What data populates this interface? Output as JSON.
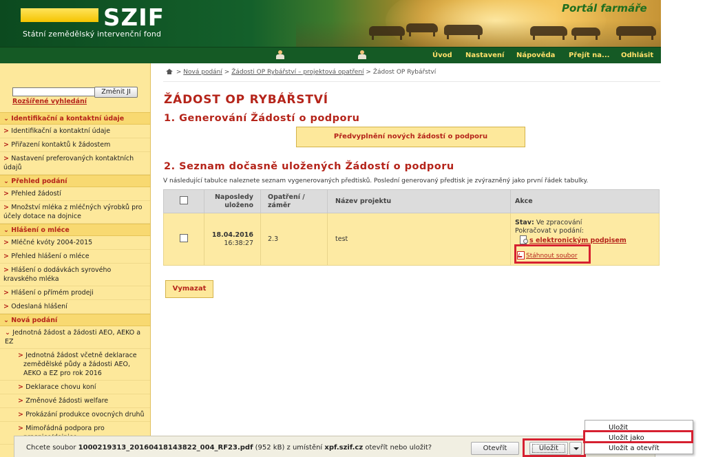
{
  "header": {
    "logo_text": "SZIF",
    "logo_subtitle": "Státní zemědělský intervenční fond",
    "portal_title": "Portál farmáře"
  },
  "nav": {
    "links": [
      "Úvod",
      "Nastavení",
      "Nápověda",
      "Přejít na...",
      "Odhlásit"
    ]
  },
  "sidebar": {
    "search_placeholder": "",
    "search_button": "Změnit JI",
    "advanced_search": "Rozšířené vyhledání",
    "sections": [
      {
        "title": "Identifikační a kontaktní údaje",
        "items": [
          "Identifikační a kontaktní údaje",
          "Přiřazení kontaktů k žádostem",
          "Nastavení preferovaných kontaktních údajů"
        ]
      },
      {
        "title": "Přehled podání",
        "items": [
          "Přehled žádostí",
          "Množství mléka z mléčných výrobků pro účely dotace na dojnice"
        ]
      },
      {
        "title": "Hlášení o mléce",
        "items": [
          "Mléčné kvóty 2004-2015",
          "Přehled hlášení o mléce",
          "Hlášení o dodávkách syrového kravského mléka",
          "Hlášení o přímém prodeji",
          "Odeslaná hlášení"
        ]
      },
      {
        "title": "Nová podání",
        "items": []
      }
    ],
    "nova_podani_group": "Jednotná žádost a žádosti AEO, AEKO a EZ",
    "nova_podani_subitems": [
      "Jednotná žádost včetně deklarace zemědělské půdy a žádosti AEO, AEKO a EZ pro rok 2016",
      "Deklarace chovu koní",
      "Změnové žádosti welfare",
      "Prokázání produkce ovocných druhů",
      "Mimořádná podpora pro prasnice/dojnice"
    ]
  },
  "breadcrumb": {
    "items": [
      "Nová podání",
      "Žádosti OP Rybářství – projektová opatření"
    ],
    "current": "Žádost OP Rybářství",
    "sep": ">"
  },
  "main": {
    "title": "ŽÁDOST OP RYBÁŘSTVÍ",
    "section1": "1. Generování Žádostí o podporu",
    "prefill_button": "Předvyplnění nových žádostí o podporu",
    "section2": "2. Seznam dočasně uložených Žádostí o podporu",
    "info": "V následující tabulce naleznete seznam vygenerovaných předtisků. Poslední generovaný předtisk je zvýrazněný jako první řádek tabulky.",
    "delete_button": "Vymazat"
  },
  "table": {
    "headers": {
      "saved": "Naposledy uloženo",
      "measure": "Opatření / záměr",
      "project": "Název projektu",
      "actions": "Akce"
    },
    "rows": [
      {
        "date": "18.04.2016",
        "time": "16:38:27",
        "measure": "2.3",
        "project": "test",
        "status_label": "Stav:",
        "status_value": "Ve zpracování",
        "continue_label": "Pokračovat v podání:",
        "sign_link": "s elektronickým podpisem",
        "download_link": "Stáhnout soubor"
      }
    ]
  },
  "download_bar": {
    "prefix": "Chcete soubor",
    "filename": "1000219313_20160418143822_004_RF23.pdf",
    "size": "(952 kB) z umístění",
    "host": "xpf.szif.cz",
    "suffix": "otevřít nebo uložit?",
    "open_button": "Otevřít",
    "save_button": "Uložit",
    "close": "×"
  },
  "save_menu": {
    "items": [
      "Uložit",
      "Uložit jako",
      "Uložit a otevřít"
    ]
  },
  "colors": {
    "accent_red": "#b5241a",
    "nav_green": "#155a25",
    "sidebar_yellow": "#fde89b",
    "highlight_red": "#d62030"
  }
}
